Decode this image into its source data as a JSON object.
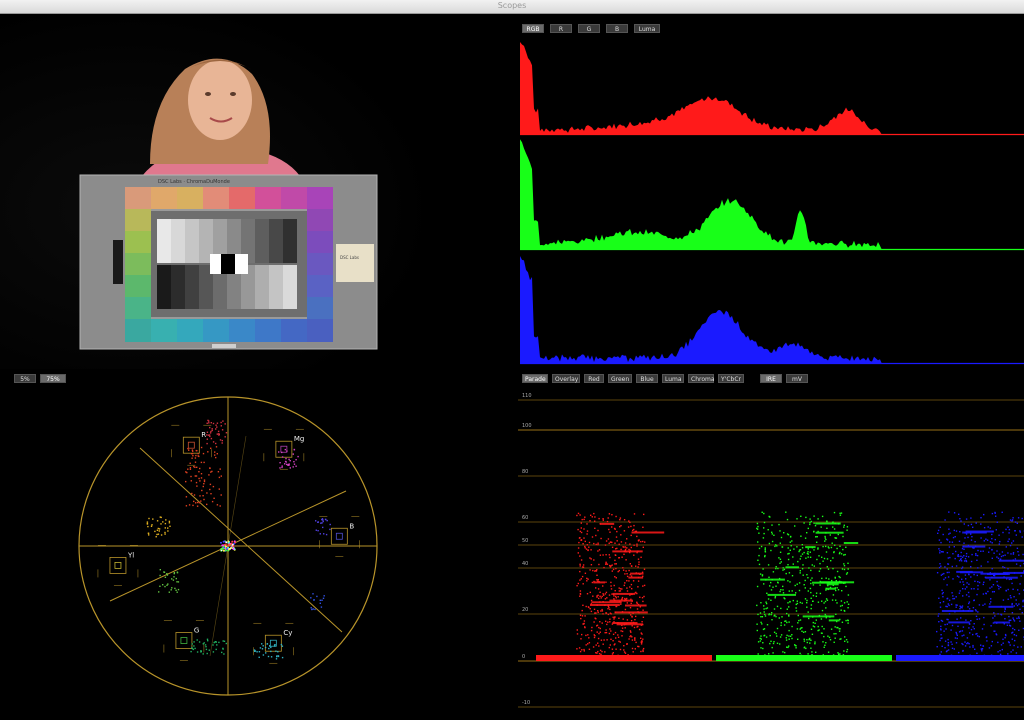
{
  "window": {
    "title": "Scopes"
  },
  "vectorscope": {
    "controls": [
      "5%",
      "75%"
    ],
    "targets": [
      "R",
      "Mg",
      "B",
      "Cy",
      "G",
      "Yl"
    ],
    "colors": {
      "graticule": "#b8942a"
    }
  },
  "histogram": {
    "buttons": [
      {
        "label": "RGB",
        "active": true
      },
      {
        "label": "R",
        "active": false
      },
      {
        "label": "G",
        "active": false
      },
      {
        "label": "B",
        "active": false
      },
      {
        "label": "Luma",
        "active": false
      }
    ],
    "colors": {
      "red": "#ff1a1a",
      "green": "#18ff18",
      "blue": "#1a1aff"
    }
  },
  "waveform": {
    "buttons": [
      {
        "label": "Parade",
        "active": true
      },
      {
        "label": "Overlay",
        "active": false
      },
      {
        "label": "Red",
        "active": false
      },
      {
        "label": "Green",
        "active": false
      },
      {
        "label": "Blue",
        "active": false
      },
      {
        "label": "Luma",
        "active": false
      },
      {
        "label": "Chroma",
        "active": false
      },
      {
        "label": "Y'CbCr",
        "active": false
      }
    ],
    "extra_buttons": [
      {
        "label": "IRE",
        "active": true
      },
      {
        "label": "mV",
        "active": false
      }
    ],
    "scale": [
      "110",
      "100",
      "80",
      "60",
      "50",
      "40",
      "20",
      "0",
      "-10"
    ],
    "colors": {
      "line": "#7a5a12"
    }
  },
  "chart_card": {
    "title": "DSC Labs · ChromaDuMonde",
    "side_label": "DSC Labs"
  }
}
